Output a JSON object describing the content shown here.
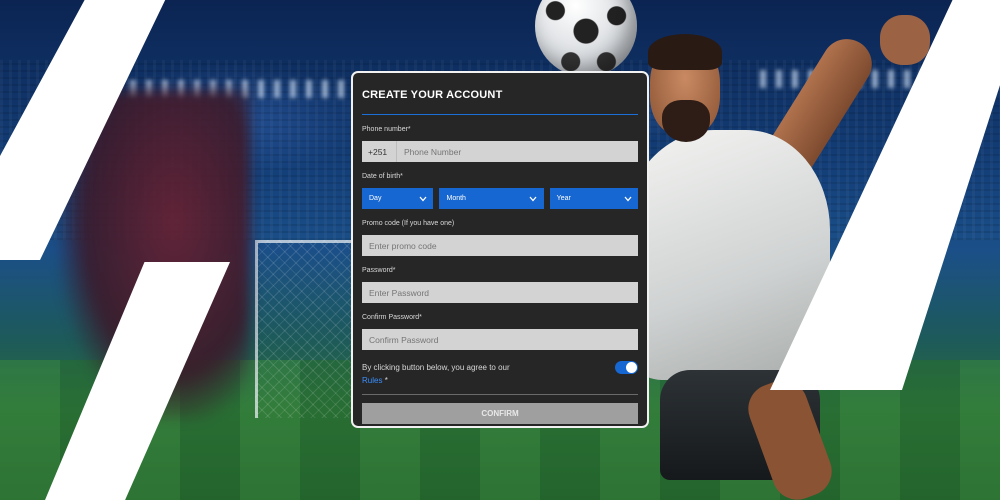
{
  "form": {
    "title": "CREATE YOUR ACCOUNT",
    "phone": {
      "label": "Phone number*",
      "code": "+251",
      "placeholder": "Phone Number"
    },
    "dob": {
      "label": "Date of birth*",
      "day": "Day",
      "month": "Month",
      "year": "Year"
    },
    "promo": {
      "label": "Promo code (If you have one)",
      "placeholder": "Enter promo code"
    },
    "password": {
      "label": "Password*",
      "placeholder": "Enter Password"
    },
    "confirm_password": {
      "label": "Confirm Password*",
      "placeholder": "Confirm Password"
    },
    "agreement": {
      "text": "By clicking button below, you agree to our",
      "link": "Rules",
      "required_mark": "*",
      "toggle_on": true
    },
    "confirm_button": "CONFIRM"
  },
  "icons": {
    "dropdown": "chevron-down-icon",
    "toggle": "toggle-switch"
  },
  "colors": {
    "panel_bg": "#262626",
    "accent_blue": "#1767d2",
    "link_blue": "#3b8fff",
    "field_bg": "#d3d3d3",
    "button_bg": "#9f9f9f"
  }
}
